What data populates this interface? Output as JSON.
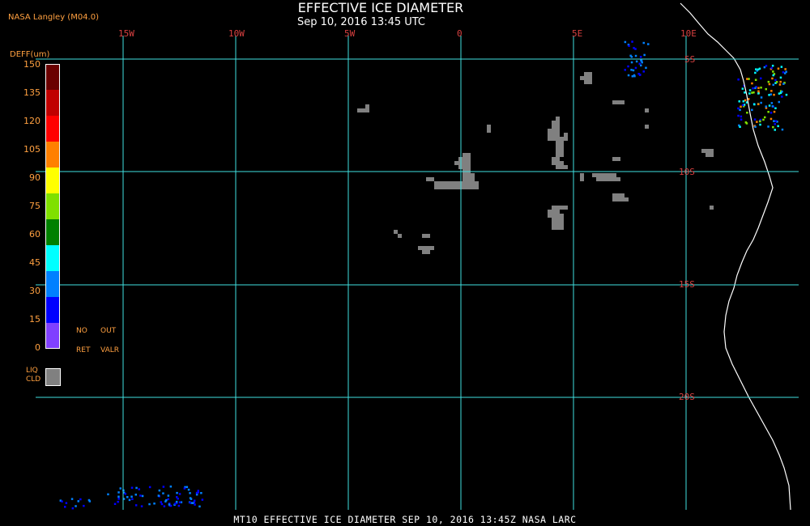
{
  "header": {
    "title": "EFFECTIVE ICE DIAMETER",
    "subtitle": "Sep 10, 2016 13:45 UTC",
    "credit": "NASA Langley (M04.0)"
  },
  "legend": {
    "title": "DEFF(um)",
    "ticks": [
      "150",
      "135",
      "120",
      "105",
      "90",
      "75",
      "60",
      "45",
      "30",
      "15",
      "0"
    ],
    "colors": [
      "#6a0000",
      "#c00000",
      "#ff0000",
      "#ff8000",
      "#ffff00",
      "#80e000",
      "#008000",
      "#00ffff",
      "#0080ff",
      "#0000ff",
      "#8040ff"
    ],
    "no_ret": [
      "NO",
      "RET"
    ],
    "out_valr": [
      "OUT",
      "VALR"
    ],
    "liq_cld": [
      "LIQ",
      "CLD"
    ],
    "liq_cld_color": "#808080"
  },
  "grid": {
    "lon_labels": [
      "15W",
      "10W",
      "5W",
      "0",
      "5E",
      "10E"
    ],
    "lat_labels": [
      "5S",
      "10S",
      "15S",
      "20S"
    ],
    "line_color": "#40e0e0"
  },
  "colors": {
    "background": "#000000",
    "liquid_cloud": "#808080",
    "coastline": "#ffffff"
  },
  "footer": "MT10  EFFECTIVE ICE DIAMETER  SEP 10, 2016 13:45Z  NASA LARC"
}
